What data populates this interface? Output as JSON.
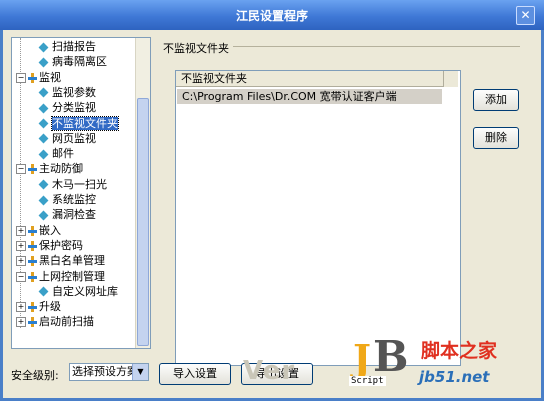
{
  "window": {
    "title": "江民设置程序",
    "close_icon": "close-icon"
  },
  "tree": {
    "items": [
      {
        "label": "扫描报告",
        "level": 2,
        "icon": "diamond-icon"
      },
      {
        "label": "病毒隔离区",
        "level": 2,
        "icon": "diamond-icon"
      },
      {
        "label": "监视",
        "level": 1,
        "expanded": true,
        "icon": "pin-icon"
      },
      {
        "label": "监视参数",
        "level": 2,
        "icon": "diamond-icon"
      },
      {
        "label": "分类监视",
        "level": 2,
        "icon": "diamond-icon"
      },
      {
        "label": "不监视文件夹",
        "level": 2,
        "icon": "diamond-icon",
        "selected": true
      },
      {
        "label": "网页监视",
        "level": 2,
        "icon": "diamond-icon"
      },
      {
        "label": "邮件",
        "level": 2,
        "icon": "diamond-icon"
      },
      {
        "label": "主动防御",
        "level": 1,
        "expanded": true,
        "icon": "pin-icon"
      },
      {
        "label": "木马一扫光",
        "level": 2,
        "icon": "diamond-icon"
      },
      {
        "label": "系统监控",
        "level": 2,
        "icon": "diamond-icon"
      },
      {
        "label": "漏洞检查",
        "level": 2,
        "icon": "diamond-icon"
      },
      {
        "label": "嵌入",
        "level": 1,
        "icon": "pin-icon"
      },
      {
        "label": "保护密码",
        "level": 1,
        "icon": "pin-icon"
      },
      {
        "label": "黑白名单管理",
        "level": 1,
        "icon": "pin-icon"
      },
      {
        "label": "上网控制管理",
        "level": 1,
        "expanded": true,
        "icon": "pin-icon"
      },
      {
        "label": "自定义网址库",
        "level": 2,
        "icon": "diamond-icon"
      },
      {
        "label": "升级",
        "level": 1,
        "icon": "pin-icon"
      },
      {
        "label": "启动前扫描",
        "level": 1,
        "icon": "pin-icon"
      }
    ]
  },
  "panel": {
    "group_label": "不监视文件夹",
    "list_header": "不监视文件夹",
    "rows": [
      "C:\\Program Files\\Dr.COM 宽带认证客户端"
    ],
    "add_button": "添加",
    "delete_button": "删除"
  },
  "bottom": {
    "security_label": "安全级别:",
    "preset_select": "选择预设方案",
    "import_button": "导入设置",
    "export_button": "导出设置"
  },
  "watermark": {
    "ghost": "Ver",
    "logo_j": "J",
    "logo_b": "B",
    "script": "Script",
    "cn": "脚本之家",
    "domain": "jb51.net"
  }
}
